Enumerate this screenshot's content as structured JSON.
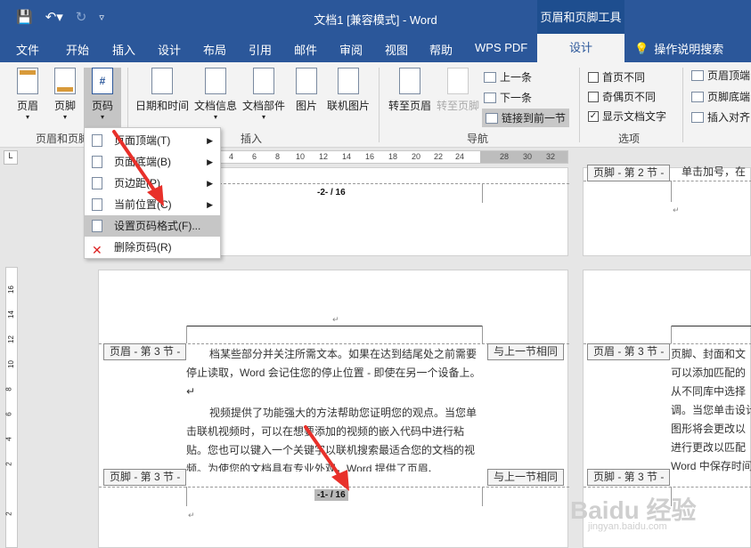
{
  "titlebar": {
    "doc_title": "文档1 [兼容模式] - Word",
    "tools_title": "页眉和页脚工具"
  },
  "tabs": [
    "文件",
    "开始",
    "插入",
    "设计",
    "布局",
    "引用",
    "邮件",
    "审阅",
    "视图",
    "帮助",
    "WPS PDF"
  ],
  "active_tab": "设计",
  "tell_me": "操作说明搜索",
  "ribbon": {
    "header": "页眉",
    "footer": "页脚",
    "page_number": "页码",
    "date_time": "日期和时间",
    "doc_info": "文档信息",
    "doc_parts": "文档部件",
    "picture": "图片",
    "online_picture": "联机图片",
    "goto_header": "转至页眉",
    "goto_footer": "转至页脚",
    "prev": "上一条",
    "next": "下一条",
    "link_prev": "链接到前一节",
    "diff_first": "首页不同",
    "diff_odd_even": "奇偶页不同",
    "show_text": "显示文档文字",
    "header_top": "页眉顶端",
    "footer_bottom": "页脚底端",
    "insert_align": "插入对齐",
    "grp_hf": "页眉和页脚",
    "grp_insert": "插入",
    "grp_nav": "导航",
    "grp_options": "选项"
  },
  "menu": [
    {
      "label": "页面顶端(T)",
      "submenu": true
    },
    {
      "label": "页面底端(B)",
      "submenu": true
    },
    {
      "label": "页边距(P)",
      "submenu": true
    },
    {
      "label": "当前位置(C)",
      "submenu": true
    },
    {
      "label": "设置页码格式(F)...",
      "submenu": false
    },
    {
      "label": "删除页码(R)",
      "submenu": false
    }
  ],
  "ruler_ticks": [
    "4",
    "6",
    "8",
    "10",
    "12",
    "14",
    "16",
    "18",
    "20",
    "22",
    "24",
    "28",
    "30",
    "32"
  ],
  "vruler_ticks": [
    "16",
    "14",
    "12",
    "10",
    "8",
    "6",
    "4",
    "2",
    "2"
  ],
  "page1": {
    "page_number_top": "-2- / 16"
  },
  "page2": {
    "header_tag": "页眉 - 第 3 节 -",
    "same_as_prev": "与上一节相同",
    "footer_tag": "页脚 - 第 3 节 -",
    "same_as_prev_footer": "与上一节相同",
    "text_p1": "档某些部分并关注所需文本。如果在达到结尾处之前需要停止读取，Word 会记住您的停止位置 - 即使在另一个设备上。↵",
    "text_p2": "视频提供了功能强大的方法帮助您证明您的观点。当您单击联机视频时，可以在想要添加的视频的嵌入代码中进行粘贴。您也可以键入一个关键字以联机搜索最适合您的文档的视频。为使您的文档具有专业外观，Word 提供了页眉、",
    "footer_number": "-1- / 16",
    "return_mark": "↵"
  },
  "right_col": {
    "header_tag_top": "页脚 - 第 2 节 -",
    "top_text": "单击加号，在",
    "header_tag": "页眉 - 第 3 节 -",
    "footer_tag": "页脚 - 第 3 节 -",
    "lines": [
      "页脚、封面和文",
      "可以添加匹配的",
      "从不同库中选择",
      "调。当您单击设计",
      "图形将会更改以",
      "进行更改以匹配",
      "Word 中保存时间"
    ]
  },
  "watermark": {
    "main": "Baidu 经验",
    "sub": "jingyan.baidu.com"
  }
}
